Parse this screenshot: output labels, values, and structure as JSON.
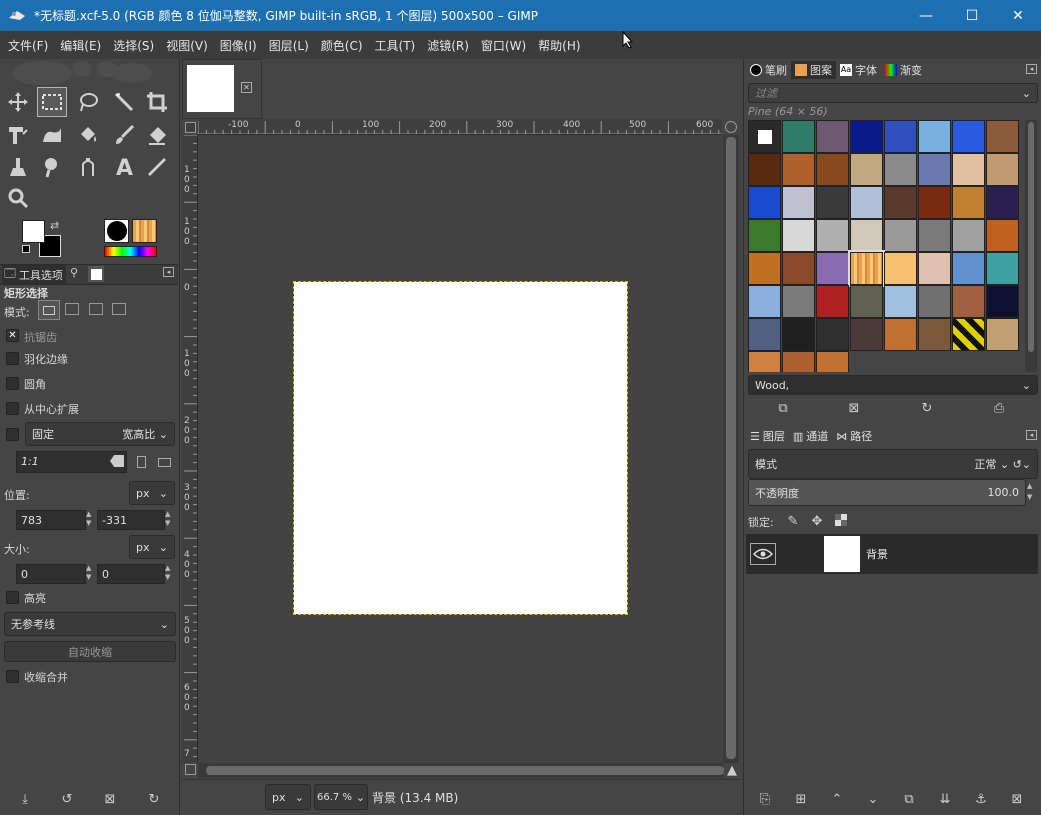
{
  "window": {
    "title": "*无标题.xcf-5.0 (RGB 颜色 8 位伽马整数, GIMP built-in sRGB, 1 个图层) 500x500 – GIMP",
    "minimize": "—",
    "maximize": "☐",
    "close": "✕"
  },
  "menu": [
    "文件(F)",
    "编辑(E)",
    "选择(S)",
    "视图(V)",
    "图像(I)",
    "图层(L)",
    "颜色(C)",
    "工具(T)",
    "滤镜(R)",
    "窗口(W)",
    "帮助(H)"
  ],
  "tool_options": {
    "tab_label": "工具选项",
    "title": "矩形选择",
    "mode_label": "模式:",
    "antialias": "抗锯齿",
    "feather": "羽化边缘",
    "rounded": "圆角",
    "expand_center": "从中心扩展",
    "fixed_label": "固定",
    "fixed_value": "宽高比",
    "ratio_value": "1:1",
    "position_label": "位置:",
    "position_unit": "px",
    "pos_x": "783",
    "pos_y": "-331",
    "size_label": "大小:",
    "size_unit": "px",
    "size_w": "0",
    "size_h": "0",
    "highlight": "高亮",
    "guides": "无参考线",
    "auto_shrink": "自动收缩",
    "shrink_merged": "收缩合并"
  },
  "ruler_h": [
    "-100",
    "0",
    "100",
    "200",
    "300",
    "400",
    "500",
    "600"
  ],
  "ruler_v": [
    "1\n0\n0",
    "1\n0\n0",
    "0",
    "1\n0\n0",
    "2\n0\n0",
    "3\n0\n0",
    "4\n0\n0",
    "5\n0\n0",
    "6\n0\n0",
    "7"
  ],
  "status": {
    "unit": "px",
    "zoom": "66.7 %",
    "info": "背景 (13.4 MB)"
  },
  "patterns_dock": {
    "tabs": [
      "笔刷",
      "图案",
      "字体",
      "渐变"
    ],
    "filter_placeholder": "过滤",
    "selected_name": "Pine (64 × 56)",
    "tag_value": "Wood,"
  },
  "layers_dock": {
    "tabs": [
      "图层",
      "通道",
      "路径"
    ],
    "mode_label": "模式",
    "mode_value": "正常",
    "opacity_label": "不透明度",
    "opacity_value": "100.0",
    "lock_label": "锁定:",
    "layer_name": "背景"
  },
  "colors": {
    "titlebar": "#1e6fb0",
    "selection": "#d4c200"
  }
}
